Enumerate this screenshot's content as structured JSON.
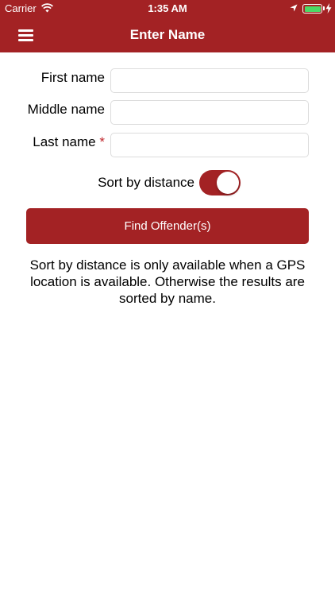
{
  "status_bar": {
    "carrier": "Carrier",
    "time": "1:35 AM",
    "battery_color": "#4cd964"
  },
  "nav": {
    "title": "Enter Name",
    "menu_icon": "hamburger-menu-icon"
  },
  "form": {
    "first_name_label": "First name",
    "middle_name_label": "Middle name",
    "last_name_label": "Last name",
    "required_marker": "*",
    "first_name_value": "",
    "middle_name_value": "",
    "last_name_value": ""
  },
  "sort": {
    "label": "Sort by distance",
    "enabled": true
  },
  "find_button_label": "Find Offender(s)",
  "info_text": "Sort by distance is only available when a GPS location is available. Otherwise the results are sorted by name.",
  "colors": {
    "brand": "#a32224",
    "required": "#c0272d"
  }
}
